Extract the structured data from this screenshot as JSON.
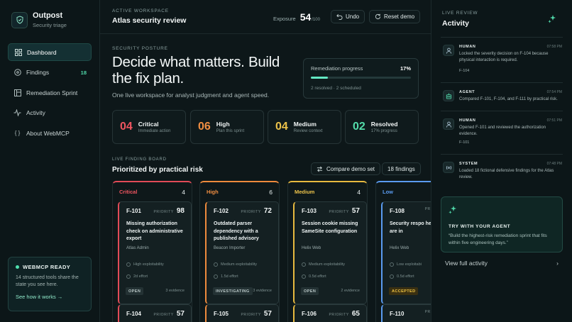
{
  "brand": {
    "title": "Outpost",
    "subtitle": "Security triage"
  },
  "sidebar": {
    "items": [
      {
        "label": "Dashboard",
        "icon": "grid-icon",
        "active": true
      },
      {
        "label": "Findings",
        "icon": "target-icon",
        "badge": "18"
      },
      {
        "label": "Remediation Sprint",
        "icon": "board-icon"
      },
      {
        "label": "Activity",
        "icon": "pulse-icon"
      },
      {
        "label": "About WebMCP",
        "icon": "braces-icon"
      }
    ],
    "mcp": {
      "title": "WEBMCP READY",
      "body": "14 structured tools share the state you see here.",
      "link": "See how it works →"
    }
  },
  "topbar": {
    "label": "ACTIVE WORKSPACE",
    "title": "Atlas security review",
    "exposure_label": "Exposure",
    "exposure_value": "54",
    "exposure_max": "/100",
    "undo": "Undo",
    "reset": "Reset demo"
  },
  "posture": {
    "label": "SECURITY POSTURE",
    "headline": "Decide what matters. Build the fix plan.",
    "subhead": "One live workspace for analyst judgment and agent speed.",
    "progress": {
      "label": "Remediation progress",
      "pct": "17%",
      "value": 0.17,
      "note": "2 resolved · 2 scheduled"
    }
  },
  "stats": [
    {
      "num": "04",
      "title": "Critical",
      "sub": "Immediate action",
      "color": "#ee5560"
    },
    {
      "num": "06",
      "title": "High",
      "sub": "Plan this sprint",
      "color": "#f08e42"
    },
    {
      "num": "04",
      "title": "Medium",
      "sub": "Review context",
      "color": "#ecc24a"
    },
    {
      "num": "02",
      "title": "Resolved",
      "sub": "17% progress",
      "color": "#53dcaa"
    }
  ],
  "board": {
    "label": "LIVE FINDING BOARD",
    "title": "Prioritized by practical risk",
    "compare": "Compare demo set",
    "count": "18 findings",
    "priority_label": "PRIORITY",
    "columns": [
      {
        "name": "Critical",
        "count": "4",
        "color": "#ee5560",
        "cards": [
          {
            "id": "F-101",
            "priority": "98",
            "title": "Missing authorization check on administrative export",
            "asset": "Atlas Admin",
            "exploit": "High exploitability",
            "effort": "2d effort",
            "status": "OPEN",
            "evidence": "3 evidence"
          },
          {
            "id": "F-104",
            "priority": "57"
          }
        ]
      },
      {
        "name": "High",
        "count": "6",
        "color": "#f08e42",
        "cards": [
          {
            "id": "F-102",
            "priority": "72",
            "title": "Outdated parser dependency with a published advisory",
            "asset": "Beacon Importer",
            "exploit": "Medium exploitability",
            "effort": "1.5d effort",
            "status": "INVESTIGATING",
            "evidence": "3 evidence"
          },
          {
            "id": "F-105",
            "priority": "57"
          }
        ]
      },
      {
        "name": "Medium",
        "count": "4",
        "color": "#ecc24a",
        "cards": [
          {
            "id": "F-103",
            "priority": "57",
            "title": "Session cookie missing SameSite configuration",
            "asset": "Helix Web",
            "exploit": "Medium exploitability",
            "effort": "0.5d effort",
            "status": "OPEN",
            "evidence": "2 evidence"
          },
          {
            "id": "F-106",
            "priority": "65"
          }
        ]
      },
      {
        "name": "Low",
        "count": "",
        "color": "#5a9bf0",
        "cards": [
          {
            "id": "F-108",
            "priority": "",
            "title": "Security respo headers are in",
            "asset": "Helix Web",
            "exploit": "Low exploitabi",
            "effort": "0.5d effort",
            "status": "ACCEPTED",
            "evidence": ""
          },
          {
            "id": "F-110",
            "priority": ""
          }
        ]
      }
    ]
  },
  "activity": {
    "label": "LIVE REVIEW",
    "title": "Activity",
    "items": [
      {
        "role": "HUMAN",
        "time": "07:58 PM",
        "text": "Locked the severity decision on F-104 because physical interaction is required.",
        "tag": "F-104",
        "icon": "person-icon"
      },
      {
        "role": "AGENT",
        "time": "07:54 PM",
        "text": "Compared F-101, F-104, and F-111 by practical risk.",
        "tag": "",
        "icon": "robot-icon"
      },
      {
        "role": "HUMAN",
        "time": "07:51 PM",
        "text": "Opened F-101 and reviewed the authorization evidence.",
        "tag": "F-101",
        "icon": "person-icon"
      },
      {
        "role": "SYSTEM",
        "time": "07:48 PM",
        "text": "Loaded 18 fictional defensive findings for the Atlas review.",
        "tag": "",
        "icon": "signal-icon"
      }
    ],
    "agent": {
      "title": "TRY WITH YOUR AGENT",
      "quote": "“Build the highest-risk remediation sprint that fits within five engineering days.”"
    },
    "view_all": "View full activity"
  }
}
